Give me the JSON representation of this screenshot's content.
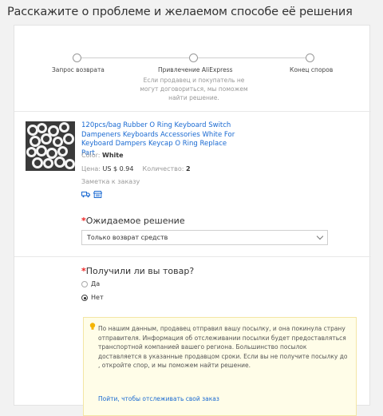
{
  "page": {
    "title": "Расскажите о проблеме и желаемом способе её решения"
  },
  "steps": [
    {
      "label": "Запрос возврата"
    },
    {
      "label": "Привлечение AliExpress",
      "description": "Если продавец и покупатель не могут договориться, мы поможем найти решение."
    },
    {
      "label": "Конец споров"
    }
  ],
  "product": {
    "title": "120pcs/bag Rubber O Ring Keyboard Switch Dampeners Keyboards Accessories White For Keyboard Dampers Keycap O Ring Replace Part",
    "color_label": "Color:",
    "color_value": "White",
    "price_label": "Цена:",
    "price_value": "US $ 0.94",
    "qty_label": "Количество:",
    "qty_value": "2",
    "note_label": "Заметка к заказу",
    "icons": [
      "truck-icon",
      "store-icon"
    ]
  },
  "expected_solution": {
    "required_mark": "*",
    "label": "Ожидаемое решение",
    "selected": "Только возврат средств"
  },
  "received": {
    "required_mark": "*",
    "label": "Получили ли вы товар?",
    "options": [
      {
        "label": "Да",
        "checked": false
      },
      {
        "label": "Нет",
        "checked": true
      }
    ]
  },
  "notice": {
    "text": "По нашим данным, продавец отправил вашу посылку, и она покинула страну отправителя. Информация об отслеживании посылки будет предоставляться транспортной компанией вашего региона. Большинство посылок доставляется в указанные продавцом сроки. Если вы не получите посылку до , откройте спор, и мы поможем найти решение.",
    "link": "Пойти, чтобы отслеживать свой заказ"
  },
  "colors": {
    "link": "#1a6ad2",
    "required": "#e22222",
    "notice_bg": "#fffde8"
  }
}
